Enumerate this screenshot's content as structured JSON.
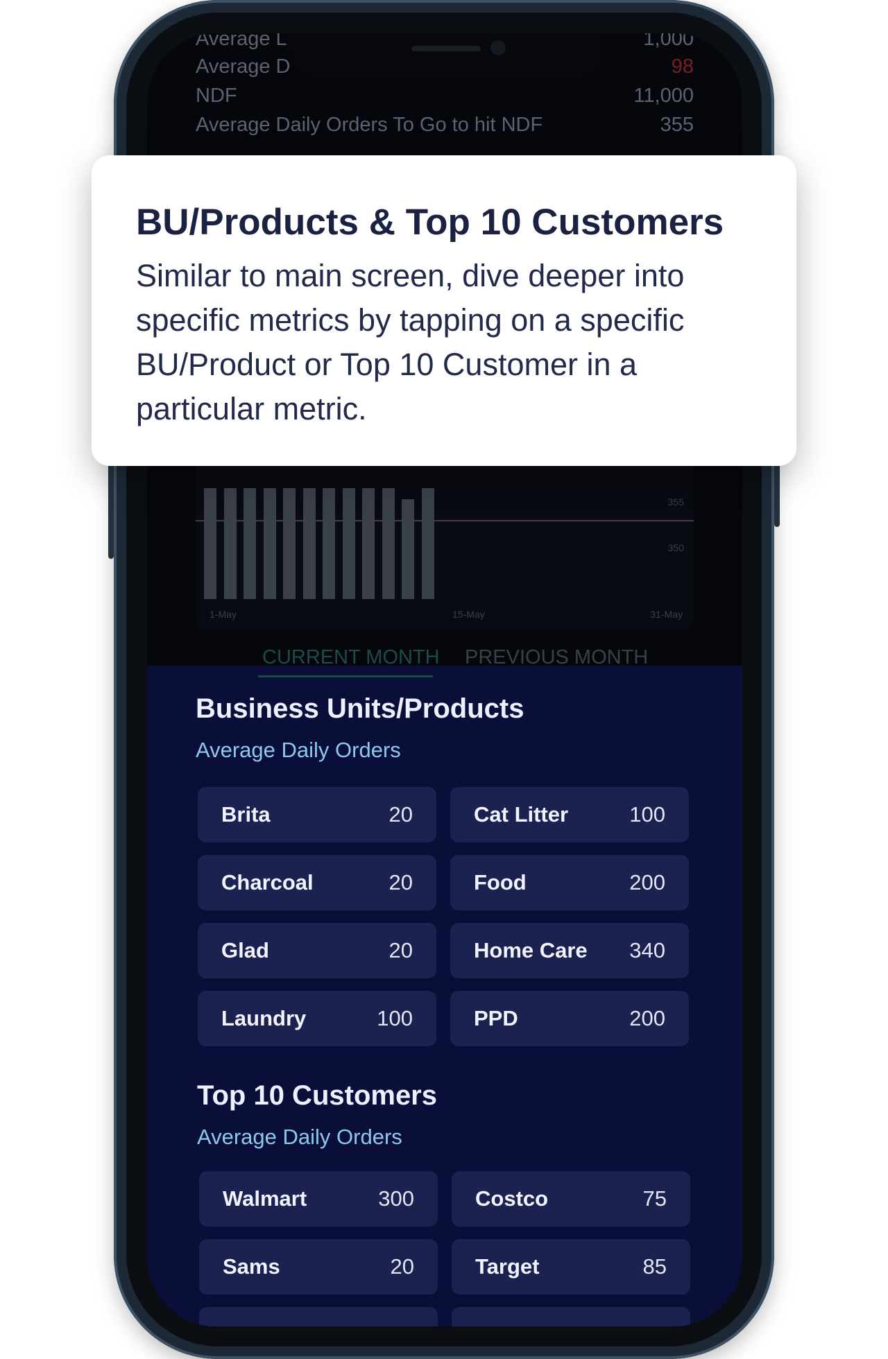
{
  "metrics": [
    {
      "label": "Average L",
      "value": "1,000",
      "value_color": "normal"
    },
    {
      "label": "Average D",
      "value": "98",
      "value_color": "red"
    },
    {
      "label": "NDF",
      "value": "11,000",
      "value_color": "normal"
    },
    {
      "label": "Average Daily Orders To Go to hit NDF",
      "value": "355",
      "value_color": "normal"
    }
  ],
  "chart": {
    "x_ticks": [
      "1-May",
      "15-May",
      "31-May"
    ],
    "y_ticks": [
      "355",
      "350"
    ]
  },
  "chart_data": {
    "type": "bar",
    "x_ticks": [
      "1-May",
      "15-May",
      "31-May"
    ],
    "y_ticks": [
      "355",
      "350"
    ],
    "values": [
      1,
      1,
      1,
      1,
      1,
      1,
      1,
      1,
      1,
      1,
      0.9,
      1
    ]
  },
  "tabs": [
    {
      "label": "CURRENT MONTH",
      "active": true
    },
    {
      "label": "PREVIOUS MONTH",
      "active": false
    }
  ],
  "tooltip": {
    "title": "BU/Products & Top 10 Customers",
    "body": "Similar to main screen, dive deeper into specific metrics by tapping on a specific BU/Product or Top 10 Customer in a particular metric."
  },
  "business_units": {
    "title": "Business Units/Products",
    "subtitle": "Average Daily Orders",
    "items": [
      {
        "name": "Brita",
        "value": "20"
      },
      {
        "name": "Cat Litter",
        "value": "100"
      },
      {
        "name": "Charcoal",
        "value": "20"
      },
      {
        "name": "Food",
        "value": "200"
      },
      {
        "name": "Glad",
        "value": "20"
      },
      {
        "name": "Home Care",
        "value": "340"
      },
      {
        "name": "Laundry",
        "value": "100"
      },
      {
        "name": "PPD",
        "value": "200"
      }
    ]
  },
  "top_customers": {
    "title": "Top 10 Customers",
    "subtitle": "Average Daily Orders",
    "items": [
      {
        "name": "Walmart",
        "value": "300"
      },
      {
        "name": "Costco",
        "value": "75"
      },
      {
        "name": "Sams",
        "value": "20"
      },
      {
        "name": "Target",
        "value": "85"
      }
    ]
  }
}
